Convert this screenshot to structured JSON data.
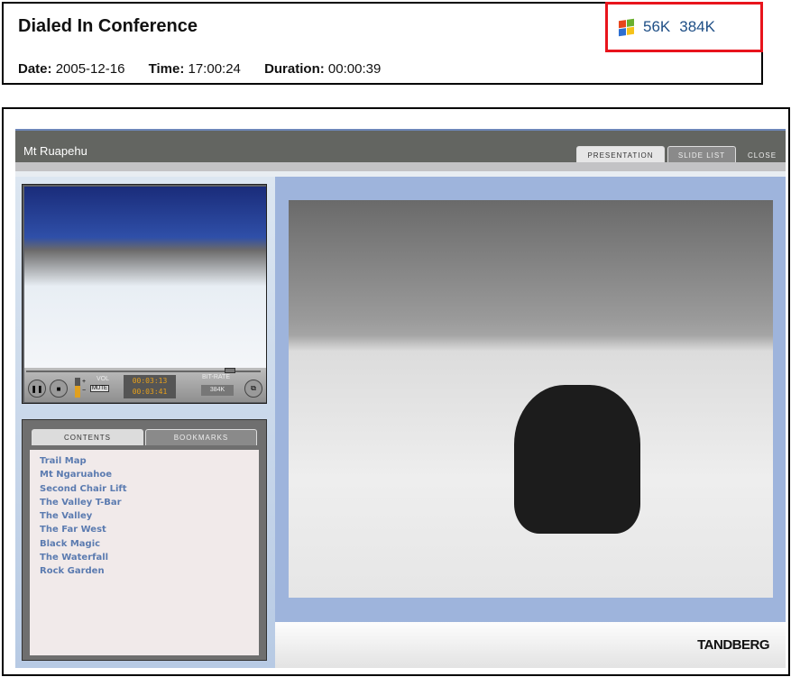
{
  "header": {
    "title": "Dialed In Conference",
    "date_label": "Date:",
    "date": "2005-12-16",
    "time_label": "Time:",
    "time": "17:00:24",
    "duration_label": "Duration:",
    "duration": "00:00:39"
  },
  "bitrates": {
    "icon": "windows-media-icon",
    "low": "56K",
    "high": "384K"
  },
  "player": {
    "title": "Mt Ruapehu",
    "tabs": [
      "PRESENTATION",
      "SLIDE LIST"
    ],
    "close": "CLOSE",
    "controls": {
      "vol": "VOL",
      "mute": "MUTE",
      "elapsed": "00:03:13",
      "total": "00:03:41",
      "bitrate_label": "BIT-RATE",
      "bitrate": "384K"
    },
    "content_tabs": [
      "CONTENTS",
      "BOOKMARKS"
    ],
    "contents": [
      "Trail Map",
      "Mt Ngaruahoe",
      "Second Chair Lift",
      "The Valley T-Bar",
      "The Valley",
      "The Far West",
      "Black Magic",
      "The Waterfall",
      "Rock Garden"
    ],
    "logo": "TANDBERG"
  }
}
